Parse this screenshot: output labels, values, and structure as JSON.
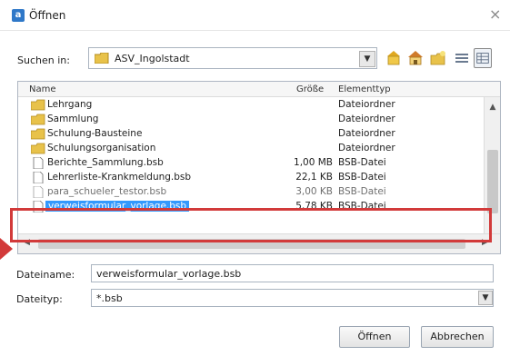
{
  "dialog": {
    "title": "Öffnen",
    "app_icon_glyph": "a",
    "close_glyph": "×"
  },
  "lookin": {
    "label": "Suchen in:",
    "value": "ASV_Ingolstadt",
    "dropdown_glyph": "▼"
  },
  "toolbar": {
    "icons": [
      "up-folder-icon",
      "home-icon",
      "new-folder-icon",
      "list-view-icon",
      "details-view-icon"
    ]
  },
  "columns": {
    "name": "Name",
    "size": "Größe",
    "type": "Elementtyp"
  },
  "files": [
    {
      "name": "Lehrgang",
      "size": "",
      "type": "Dateiordner",
      "kind": "folder"
    },
    {
      "name": "Sammlung",
      "size": "",
      "type": "Dateiordner",
      "kind": "folder"
    },
    {
      "name": "Schulung-Bausteine",
      "size": "",
      "type": "Dateiordner",
      "kind": "folder"
    },
    {
      "name": "Schulungsorganisation",
      "size": "",
      "type": "Dateiordner",
      "kind": "folder"
    },
    {
      "name": "Berichte_Sammlung.bsb",
      "size": "1,00 MB",
      "type": "BSB-Datei",
      "kind": "file"
    },
    {
      "name": "Lehrerliste-Krankmeldung.bsb",
      "size": "22,1 KB",
      "type": "BSB-Datei",
      "kind": "file"
    },
    {
      "name": "para_schueler_testor.bsb",
      "size": "3,00 KB",
      "type": "BSB-Datei",
      "kind": "file"
    },
    {
      "name": "verweisformular_vorlage.bsb",
      "size": "5,78 KB",
      "type": "BSB-Datei",
      "kind": "file"
    }
  ],
  "selected_file": "verweisformular_vorlage.bsb",
  "filename": {
    "label": "Dateiname:",
    "value": "verweisformular_vorlage.bsb"
  },
  "filetype": {
    "label": "Dateityp:",
    "value": "*.bsb",
    "dropdown_glyph": "▼"
  },
  "buttons": {
    "open": "Öffnen",
    "cancel": "Abbrechen"
  },
  "colors": {
    "selection": "#3399ff",
    "highlight_annotation": "#d23a3a",
    "folder_yellow": "#e8c24a"
  }
}
